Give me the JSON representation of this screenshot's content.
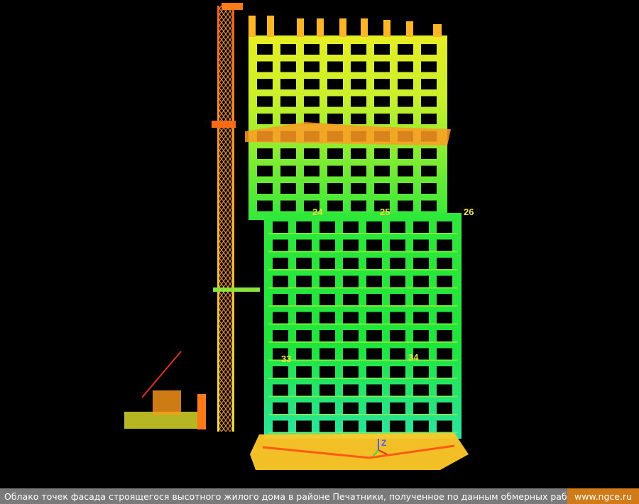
{
  "labels": [
    {
      "id": "label-24",
      "text": "24"
    },
    {
      "id": "label-25",
      "text": "25"
    },
    {
      "id": "label-26",
      "text": "26"
    },
    {
      "id": "label-33",
      "text": "33"
    },
    {
      "id": "label-34",
      "text": "34"
    }
  ],
  "axis": {
    "z": "Z"
  },
  "caption": {
    "text": "Облако точек фасада строящегося высотного жилого дома в районе Печатники, полученное по данным обмерных работ",
    "site": "www.ngce.ru"
  },
  "colors": {
    "background": "#000000",
    "point_green": "#22e63a",
    "point_yellow": "#e8ef2a",
    "point_orange": "#ff8a1a",
    "point_red": "#e02a12",
    "caption_bar": "#7a7a7a",
    "site_badge": "#d07a18"
  }
}
